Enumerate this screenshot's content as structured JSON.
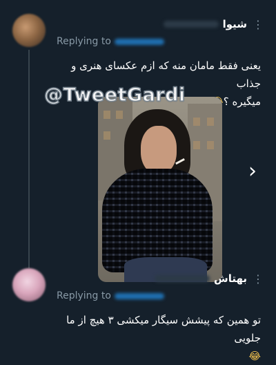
{
  "watermark": "@TweetGardi",
  "tweets": [
    {
      "display_name": "شیوا",
      "replying_label": "Replying to",
      "text_line1": "یعنی فقط مامان منه که ازم عکسای هنری و جذاب",
      "text_line2": "میگیره ؟",
      "emoji": "😂😂",
      "more": "⋮"
    },
    {
      "display_name": "بهتاش",
      "replying_label": "Replying to",
      "text_line1": "تو همین که پیشش سیگار میکشی ۳ هیچ از ما جلویی",
      "emoji": "😂",
      "more": "⋮"
    }
  ],
  "media": {
    "next_arrow": "›"
  },
  "colors": {
    "background": "#15202b",
    "secondary_text": "#8899a6",
    "link": "#1d9bf0"
  }
}
